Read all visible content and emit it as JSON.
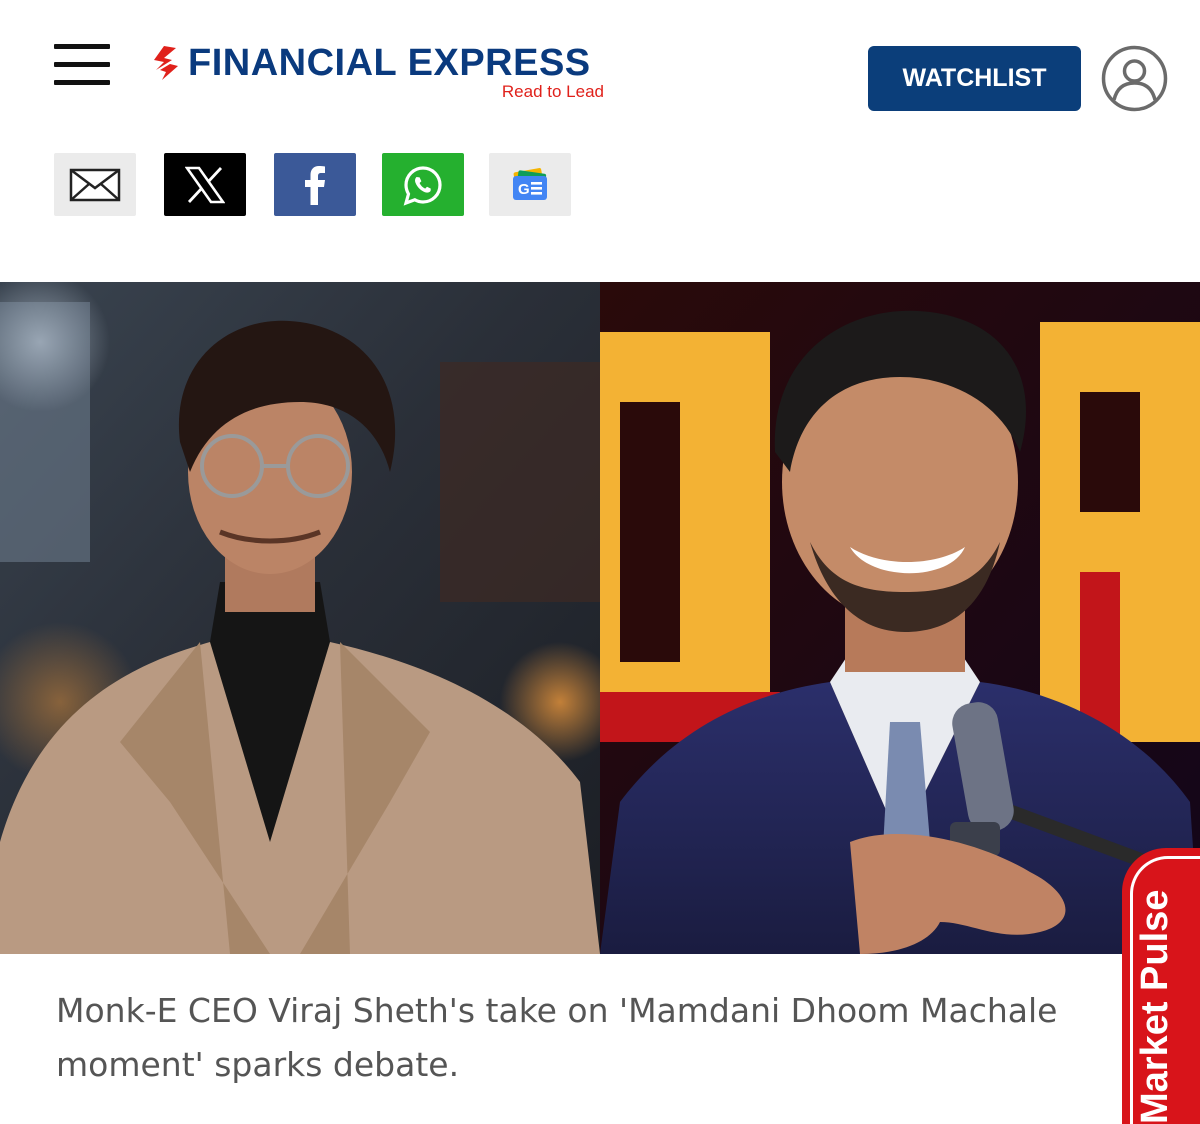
{
  "header": {
    "brand_name": "FINANCIAL EXPRESS",
    "tagline": "Read to Lead",
    "watchlist_label": "WATCHLIST",
    "brand_color": "#0a3a7e",
    "accent_color": "#e0211b"
  },
  "share_bar": {
    "items": [
      {
        "icon": "email-icon"
      },
      {
        "icon": "x-icon"
      },
      {
        "icon": "facebook-icon"
      },
      {
        "icon": "whatsapp-icon"
      },
      {
        "icon": "google-news-icon"
      }
    ]
  },
  "article": {
    "image_left": "photo of Monk-E CEO Viraj Sheth",
    "image_right": "photo of smiling man at microphone",
    "caption": "Monk-E CEO Viraj Sheth's take on 'Mamdani Dhoom Machale moment' sparks debate."
  },
  "market_pulse": {
    "label": "Market Pulse",
    "color": "#d8141a"
  }
}
